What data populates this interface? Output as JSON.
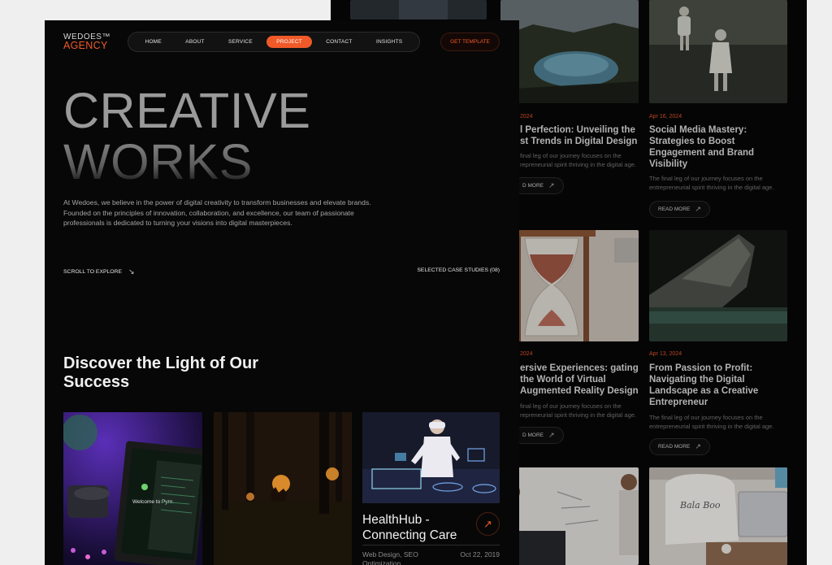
{
  "blog": {
    "posts": [
      {
        "date": "2024",
        "title": "l Perfection: Unveiling the st Trends in Digital Design",
        "excerpt": "final leg of our journey focuses on the repreneurial spirit thriving in the digital age.",
        "more": "D MORE"
      },
      {
        "date": "Apr 16, 2024",
        "title": "Social Media Mastery: Strategies to Boost Engagement and Brand Visibility",
        "excerpt": "The final leg of our journey focuses on the entrepreneurial spirit thriving in the digital age.",
        "more": "READ MORE"
      },
      {
        "date": "2024",
        "title": "ersive Experiences: gating the World of Virtual Augmented Reality Design",
        "excerpt": "final leg of our journey focuses on the repreneurial spirit thriving in the digital age.",
        "more": "D MORE"
      },
      {
        "date": "Apr 13, 2024",
        "title": "From Passion to Profit: Navigating the Digital Landscape as a Creative Entrepreneur",
        "excerpt": "The final leg of our journey focuses on the entrepreneurial spirit thriving in the digital age.",
        "more": "READ MORE"
      }
    ],
    "shirt_text": "Bala Boo"
  },
  "header": {
    "logo_line1": "WEDOES™",
    "logo_line2": "AGENCY",
    "nav": [
      "HOME",
      "ABOUT",
      "SERVICE",
      "PROJECT",
      "CONTACT",
      "INSIGHTS"
    ],
    "active_nav": "PROJECT",
    "cta": "GET TEMPLATE"
  },
  "hero": {
    "line1": "CREATIVE",
    "line2": "WORKS",
    "intro": "At Wedoes, we believe in the power of digital creativity to transform businesses and elevate brands. Founded on the principles of innovation, collaboration, and excellence, our team of passionate professionals is dedicated to turning your visions into digital masterpieces.",
    "scroll_label": "SCROLL TO EXPLORE",
    "cases_label": "SELECTED CASE STUDIES (08)"
  },
  "discover": {
    "heading": "Discover the Light of Our Success"
  },
  "projects": {
    "screen_text": "Welcome to Pyro.",
    "featured": {
      "title": "HealthHub - Connecting Care",
      "tags": "Web Design, SEO Optimization",
      "date": "Oct 22, 2019"
    }
  },
  "colors": {
    "accent": "#f05a28",
    "background": "#070707",
    "page": "#efefef"
  },
  "icons": {
    "arrow_down_right": "↘",
    "arrow_up_right": "↗"
  }
}
